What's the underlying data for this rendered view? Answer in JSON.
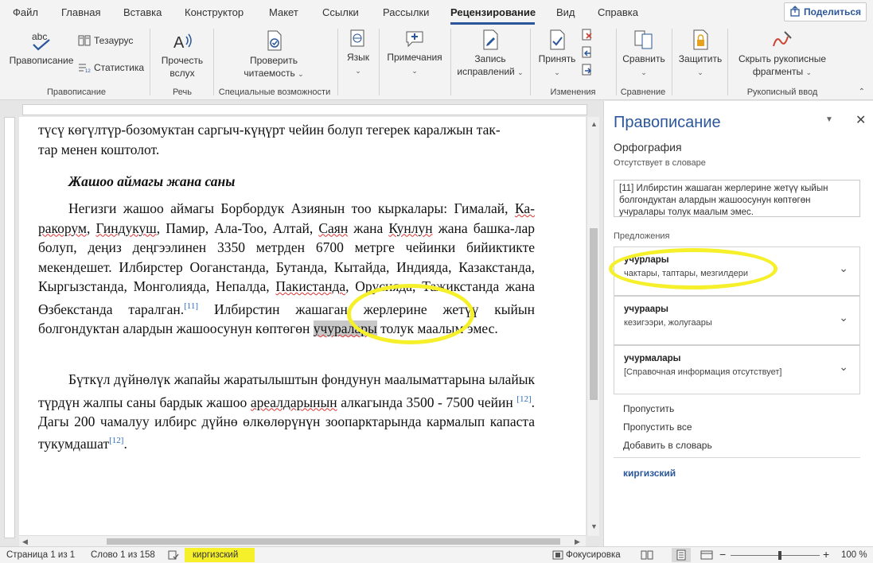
{
  "tabs": [
    {
      "label": "Файл",
      "active": false
    },
    {
      "label": "Главная",
      "active": false
    },
    {
      "label": "Вставка",
      "active": false
    },
    {
      "label": "Конструктор",
      "active": false
    },
    {
      "label": "Макет",
      "active": false
    },
    {
      "label": "Ссылки",
      "active": false
    },
    {
      "label": "Рассылки",
      "active": false
    },
    {
      "label": "Рецензирование",
      "active": true
    },
    {
      "label": "Вид",
      "active": false
    },
    {
      "label": "Справка",
      "active": false
    }
  ],
  "share": "Поделиться",
  "ribbon": {
    "spelling": "Правописание",
    "thesaurus": "Тезаурус",
    "statistics": "Статистика",
    "group_spelling": "Правописание",
    "read_aloud_1": "Прочесть",
    "read_aloud_2": "вслух",
    "group_speech": "Речь",
    "accessibility_1": "Проверить",
    "accessibility_2": "читаемость",
    "group_accessibility": "Специальные возможности",
    "language": "Язык",
    "comments": "Примечания",
    "track_1": "Запись",
    "track_2": "исправлений",
    "accept": "Принять",
    "group_changes": "Изменения",
    "compare": "Сравнить",
    "group_compare": "Сравнение",
    "protect": "Защитить",
    "ink_1": "Скрыть рукописные",
    "ink_2": "фрагменты",
    "group_ink": "Рукописный ввод"
  },
  "document": {
    "para1_line1": "түсү көгүлтүр-бозомуктан саргыч-күңүрт чейин болуп тегерек каралжын так-",
    "para1_line2": "тар менен коштолот.",
    "heading": "Жашоо аймагы жана саны",
    "p2_a": "Негизги жашоо аймагы Борбордук Азиянын тоо кыркалары: Гималай, ",
    "p2_kara": "Ка-",
    "p2_rakorum": "ракорум",
    "p2_b": ", ",
    "p2_gindukush": "Гиндукуш",
    "p2_c": ", Памир, Ала-Тоо, Алтай, ",
    "p2_sayan": "Саян",
    "p2_d": " жана ",
    "p2_kunlun": "Кунлун",
    "p2_e": " жана башка-лар болуп, деңиз деңгээлинен 3350 метрден 6700 метрге чейинки бийиктикте мекендешет. Илбирстер Ооганстанда, Бутанда, Кытайда, Индияда, Казакстанда, Кыргызстанда, Монголияда, Непалда, ",
    "p2_pakistan": "Пакистанда",
    "p2_f": ", Орусияда, Тажикстанда жана Өзбекстанда таралган.",
    "ref11": "[11]",
    "p2_g": " Илбирстин жашаган жерлерине жетүү кыйын болгондуктан алардын жашоосунун көптөгөн ",
    "p2_word": "учуралары",
    "p2_h": " толук маалым эмес.",
    "p3_a": "Бүткүл дүйнөлүк жапайы жаратылыштын фондунун маалыматтарына ылайык түрдүн жалпы саны бардык жашоо ",
    "p3_area": "ареалдарынын",
    "p3_b": " алкагында 3500 - 7500 чейин ",
    "ref12a": "[12]",
    "p3_c": ". Дагы 200 чамалуу илбирс дүйнө өлкөлөрүнүн зоопарктарында кармалып капаста тукумдашат",
    "ref12b": "[12]",
    "p3_d": "."
  },
  "pane": {
    "title": "Правописание",
    "section": "Орфография",
    "not_in_dict": "Отсутствует в словаре",
    "context": "[11] Илбирстин жашаган жерлерине жетүү кыйын болгондуктан алардын жашоосунун көптөгөн учуралары толук маалым эмес.",
    "suggestions_label": "Предложения",
    "suggestions": [
      {
        "word": "учурлары",
        "syn": "чактары, таптары, мезгилдери"
      },
      {
        "word": "учураары",
        "syn": "кезигээри, жолугаары"
      },
      {
        "word": "учурмалары",
        "syn": "[Справочная информация отсутствует]"
      }
    ],
    "ignore": "Пропустить",
    "ignore_all": "Пропустить все",
    "add_to_dict": "Добавить в словарь",
    "language": "киргизский"
  },
  "status": {
    "page": "Страница 1 из 1",
    "words": "Слово 1 из 158",
    "language": "киргизский",
    "focus": "Фокусировка",
    "zoom": "100 %"
  },
  "colors": {
    "accent": "#2b579a",
    "highlight": "#f6f02b"
  }
}
